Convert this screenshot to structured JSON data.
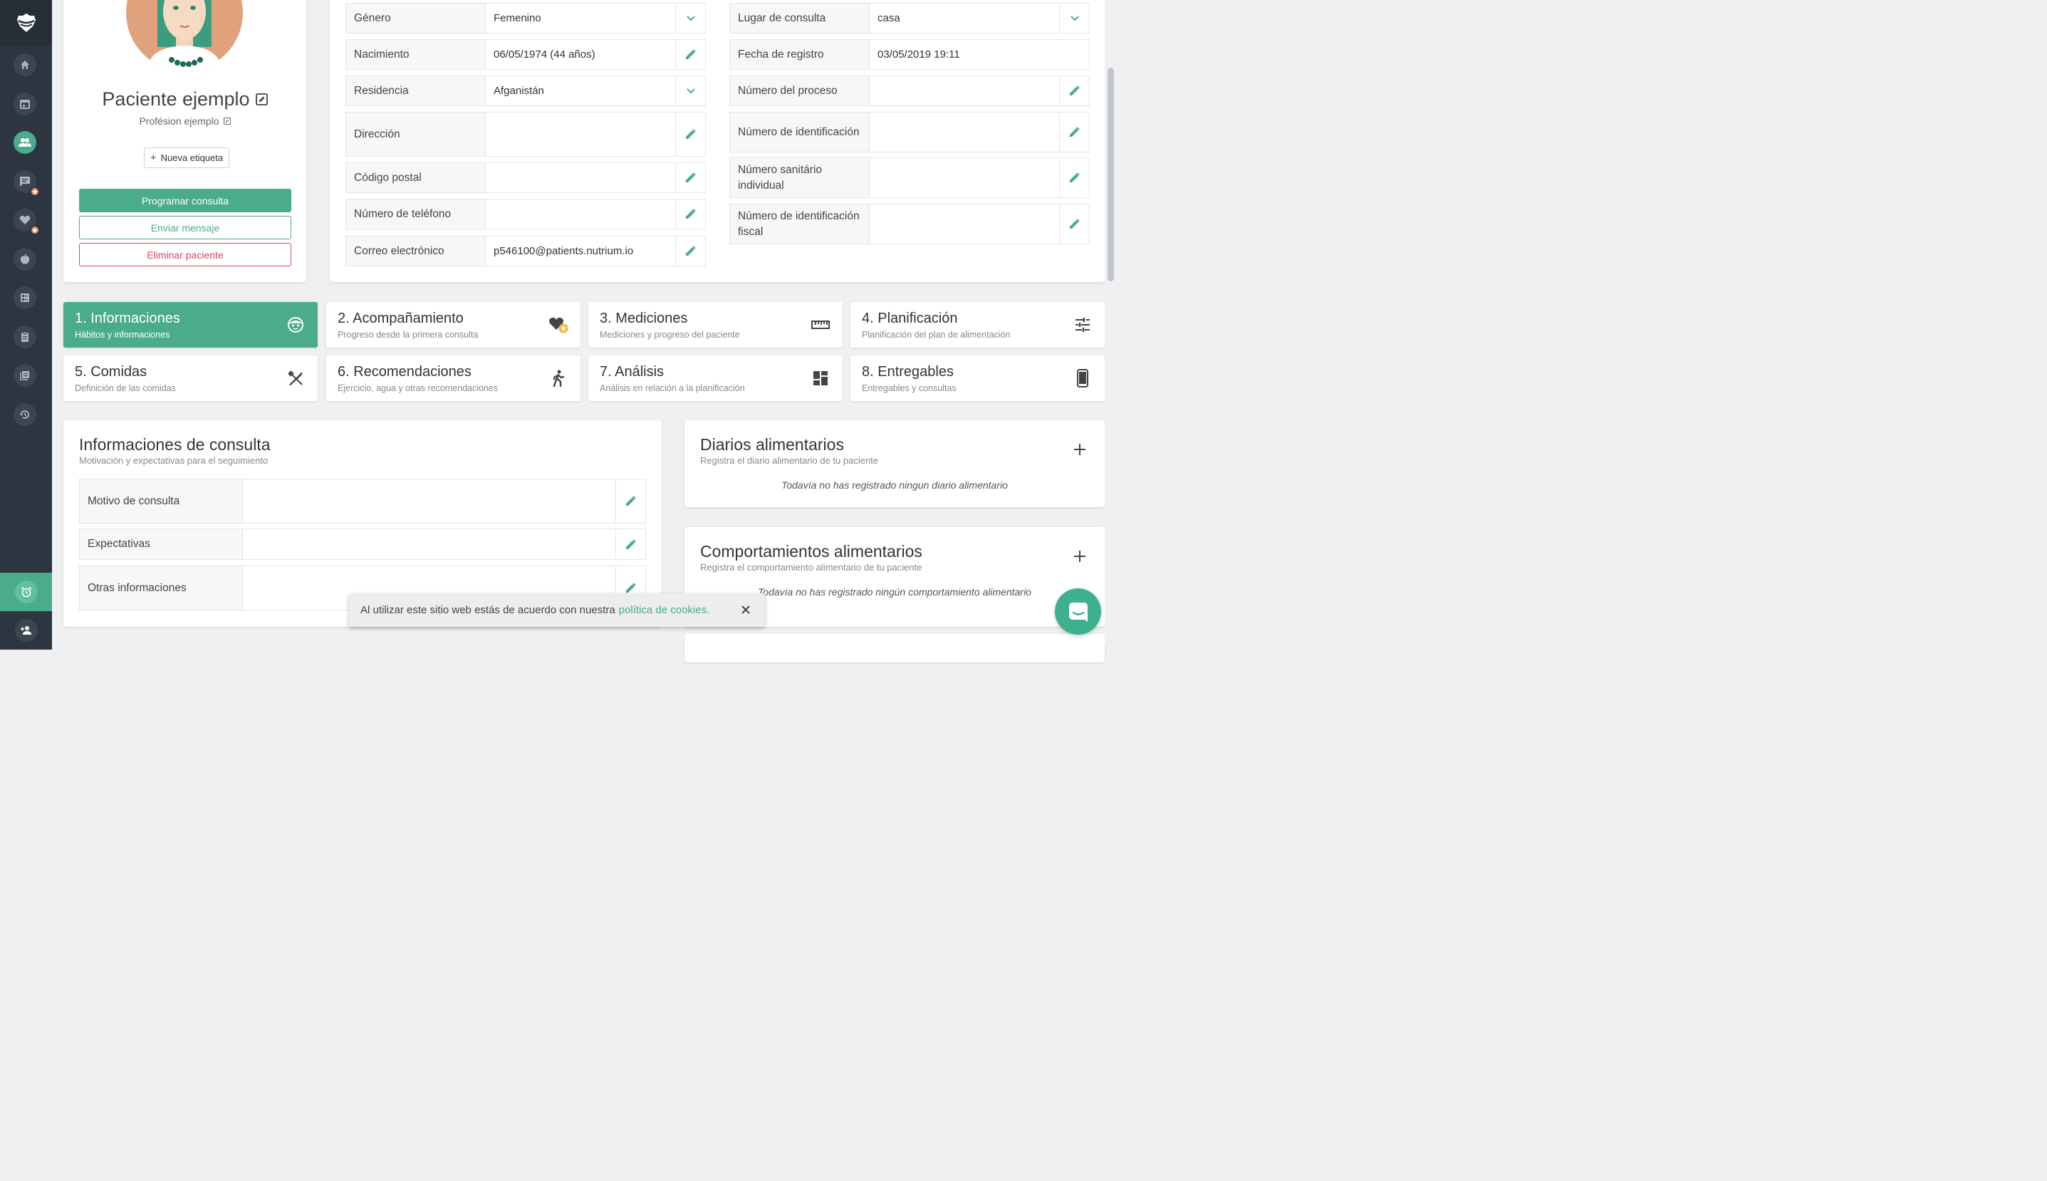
{
  "colors": {
    "accent": "#4aab8d",
    "danger": "#d24b5a",
    "sidebar": "#2d3540"
  },
  "sidebar": {
    "items": [
      "home-icon",
      "calendar-icon",
      "patients-icon",
      "messages-icon",
      "heart-icon",
      "apple-icon",
      "checklist-icon",
      "clipboard-icon",
      "book-icon",
      "history-icon"
    ],
    "bottom": [
      "alarm-icon",
      "add-user-icon"
    ]
  },
  "profile": {
    "name": "Paciente ejemplo",
    "profession": "Profésion ejemplo",
    "new_tag": "Nueva etiqueta",
    "schedule": "Programar consulta",
    "message": "Enviar mensaje",
    "delete": "Eliminar paciente"
  },
  "personal_fields": {
    "gender": {
      "label": "Género",
      "value": "Femenino"
    },
    "birth": {
      "label": "Nacimiento",
      "value": "06/05/1974 (44 años)"
    },
    "residence": {
      "label": "Residencia",
      "value": "Afganistán"
    },
    "address": {
      "label": "Dirección",
      "value": ""
    },
    "postal": {
      "label": "Código postal",
      "value": ""
    },
    "phone": {
      "label": "Número de teléfono",
      "value": ""
    },
    "email": {
      "label": "Correo electrónico",
      "value": "p546100@patients.nutrium.io"
    }
  },
  "admin_fields": {
    "place": {
      "label": "Lugar de consulta",
      "value": "casa"
    },
    "registered": {
      "label": "Fecha de registro",
      "value": "03/05/2019 19:11"
    },
    "process": {
      "label": "Número del proceso",
      "value": ""
    },
    "id_number": {
      "label": "Número de identificación",
      "value": ""
    },
    "health": {
      "label": "Número sanitário individual",
      "value": ""
    },
    "tax": {
      "label": "Número de identificación fiscal",
      "value": ""
    }
  },
  "steps": [
    {
      "title": "1. Informaciones",
      "subtitle": "Hábitos y informaciones",
      "icon": "face-icon"
    },
    {
      "title": "2. Acompañamiento",
      "subtitle": "Progreso desde la primera consulta",
      "icon": "heart-star-icon"
    },
    {
      "title": "3. Mediciones",
      "subtitle": "Mediciones y progreso del paciente",
      "icon": "ruler-icon"
    },
    {
      "title": "4. Planificación",
      "subtitle": "Planificación del plan de alimentación",
      "icon": "sliders-icon"
    },
    {
      "title": "5. Comidas",
      "subtitle": "Definición de las comidas",
      "icon": "cutlery-icon"
    },
    {
      "title": "6. Recomendaciones",
      "subtitle": "Ejercicio, agua y otras recomendaciones",
      "icon": "walking-icon"
    },
    {
      "title": "7. Análisis",
      "subtitle": "Análisis en relación a la planificación",
      "icon": "dashboard-icon"
    },
    {
      "title": "8. Entregables",
      "subtitle": "Entregables y consultas",
      "icon": "phone-icon"
    }
  ],
  "consultation": {
    "title": "Informaciones de consulta",
    "subtitle": "Motivación y expectativas para el seguimiento",
    "rows": [
      {
        "label": "Motivo de consulta",
        "value": ""
      },
      {
        "label": "Expectativas",
        "value": ""
      },
      {
        "label": "Otras informaciones",
        "value": ""
      }
    ]
  },
  "food_diaries": {
    "title": "Diarios alimentarios",
    "subtitle": "Registra el diario alimentario de tu paciente",
    "empty": "Todavía no has registrado ningun diario alimentario"
  },
  "food_behaviors": {
    "title": "Comportamientos alimentarios",
    "subtitle": "Registra el comportamiento alimentario de tu paciente",
    "empty": "Todavía no has registrado ningún comportamiento alimentario"
  },
  "cookie": {
    "text": "Al utilizar este sitio web estás de acuerdo con nuestra",
    "link": "política de cookies."
  }
}
